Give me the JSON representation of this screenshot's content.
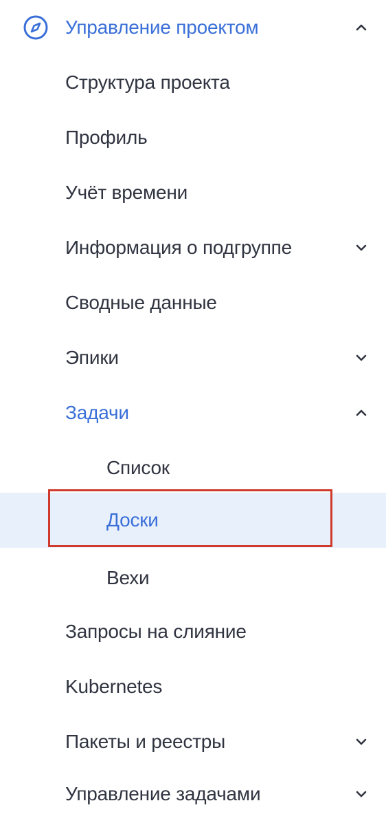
{
  "colors": {
    "accent": "#3a6fd8",
    "text": "#303440",
    "selected_bg": "#e8f0fb",
    "highlight_border": "#cf3a2c"
  },
  "section": {
    "label": "Управление проектом",
    "icon": "compass-icon",
    "expanded": true
  },
  "items": [
    {
      "label": "Структура проекта"
    },
    {
      "label": "Профиль"
    },
    {
      "label": "Учёт времени"
    },
    {
      "label": "Информация о подгруппе",
      "chevron": "down"
    },
    {
      "label": "Сводные данные"
    },
    {
      "label": "Эпики",
      "chevron": "down"
    },
    {
      "label": "Задачи",
      "chevron": "up",
      "active": true,
      "children": [
        {
          "label": "Список"
        },
        {
          "label": "Доски",
          "selected": true
        },
        {
          "label": "Вехи"
        }
      ]
    },
    {
      "label": "Запросы на слияние"
    },
    {
      "label": "Kubernetes"
    },
    {
      "label": "Пакеты и реестры",
      "chevron": "down"
    },
    {
      "label": "Управление задачами",
      "chevron": "down"
    }
  ]
}
